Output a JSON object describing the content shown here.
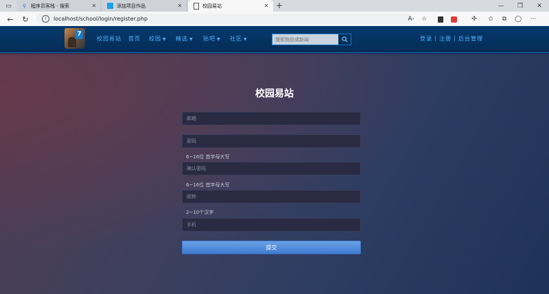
{
  "browser": {
    "tabs": [
      {
        "title": "程序员客栈 - 搜索",
        "favicon": "search-icon",
        "active": false
      },
      {
        "title": "添加项目作品",
        "favicon": "site-icon",
        "active": false
      },
      {
        "title": "校园易站",
        "favicon": "page-icon",
        "active": true
      }
    ],
    "url": "localhost/school/login/register.php"
  },
  "site": {
    "nav": {
      "menu": [
        {
          "label": "校园易站",
          "caret": false
        },
        {
          "label": "首页",
          "caret": false
        },
        {
          "label": "校园",
          "caret": true
        },
        {
          "label": "精选",
          "caret": true
        },
        {
          "label": "贴吧",
          "caret": true
        },
        {
          "label": "社区",
          "caret": true
        }
      ],
      "search_placeholder": "搜索物品或新闻",
      "right_links": [
        "登录",
        "注册",
        "后台管理"
      ],
      "right_separator": "|",
      "accent_color": "#4fb3ff"
    },
    "form": {
      "title": "校园易站",
      "email_placeholder": "邮箱",
      "password_placeholder": "密码",
      "password_hint": "6~16位 首字母大写",
      "confirm_placeholder": "确认密码",
      "confirm_hint": "6~16位 首字母大写",
      "nickname_placeholder": "昵称",
      "nickname_hint": "2~10个汉字",
      "phone_placeholder": "手机",
      "submit_label": "提交"
    }
  }
}
